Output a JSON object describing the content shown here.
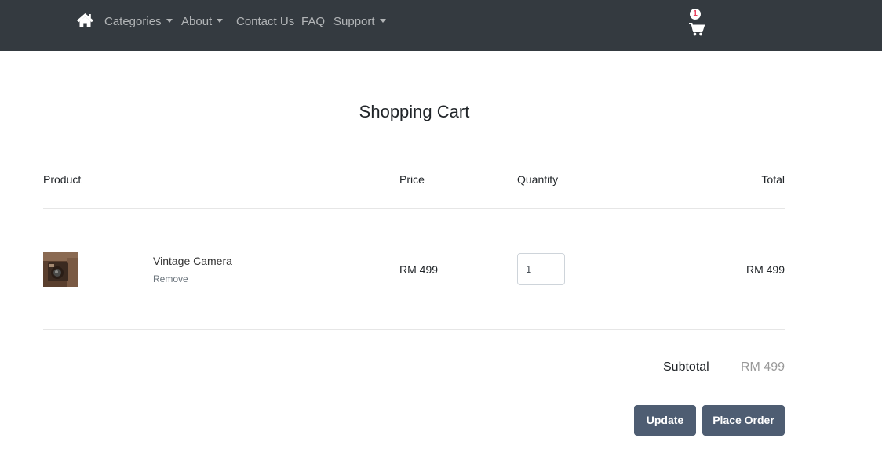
{
  "nav": {
    "home_icon": "home-icon",
    "items": [
      {
        "label": "Categories",
        "dropdown": true
      },
      {
        "label": "About",
        "dropdown": true
      },
      {
        "label": "Contact Us",
        "dropdown": false
      },
      {
        "label": "FAQ",
        "dropdown": false
      },
      {
        "label": "Support",
        "dropdown": true
      }
    ],
    "cart": {
      "icon": "shopping-cart-icon",
      "count": "1"
    }
  },
  "page": {
    "title": "Shopping Cart"
  },
  "table": {
    "headers": {
      "product": "Product",
      "price": "Price",
      "quantity": "Quantity",
      "total": "Total"
    },
    "items": [
      {
        "name": "Vintage Camera",
        "remove_label": "Remove",
        "price": "RM 499",
        "quantity": "1",
        "total": "RM 499"
      }
    ]
  },
  "summary": {
    "subtotal_label": "Subtotal",
    "subtotal_value": "RM 499"
  },
  "actions": {
    "update_label": "Update",
    "order_label": "Place Order"
  },
  "colors": {
    "navbar": "#343a40",
    "button": "#4e5d72",
    "badge_text": "#e83e5b"
  }
}
